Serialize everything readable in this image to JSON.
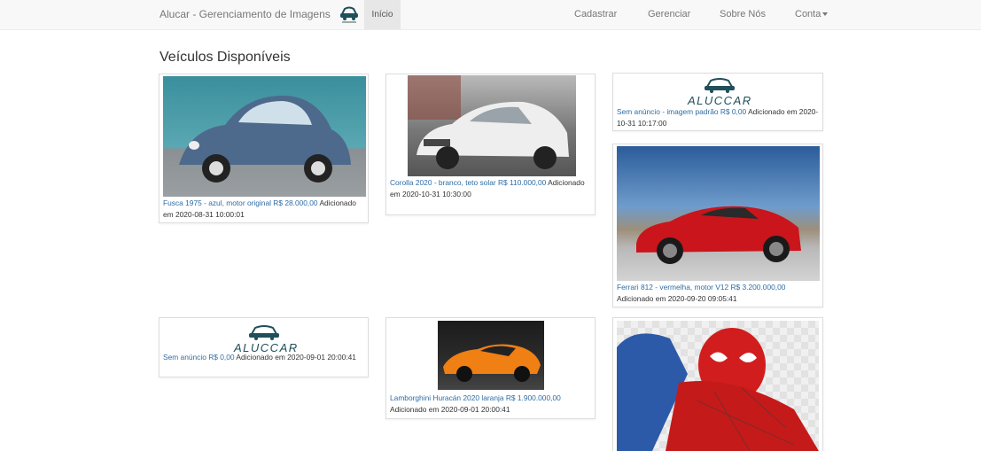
{
  "navbar": {
    "brand": "Alucar - Gerenciamento de Imagens",
    "home_label": "Início",
    "links": [
      "Cadastrar",
      "Gerenciar",
      "Sobre Nós"
    ],
    "account_label": "Conta"
  },
  "page": {
    "title": "Veículos Disponíveis"
  },
  "logo_text": "ALUCCAR",
  "cards": [
    {
      "price": "Fusca 1975 - azul, motor original R$ 28.000,00",
      "added": "Adicionado em 2020-08-31 10:00:01"
    },
    {
      "price": "Corolla 2020 - branco, teto solar R$ 110.000,00",
      "added": "Adicionado em 2020-10-31 10:30:00"
    },
    {
      "price": "Sem anúncio - imagem padrão R$ 0,00",
      "added": "Adicionado em 2020-10-31 10:17:00"
    },
    {
      "price": "Ferrari 812 - vermelha, motor V12 R$ 3.200.000,00",
      "added": "Adicionado em 2020-09-20 09:05:41"
    },
    {
      "price": "Sem anúncio R$ 0,00",
      "added": "Adicionado em 2020-09-01 20:00:41"
    },
    {
      "price": "Lamborghini Huracán 2020 laranja R$ 1.900.000,00",
      "added": "Adicionado em 2020-09-01 20:00:41"
    },
    {
      "price": "",
      "added": ""
    }
  ],
  "colors": {
    "navbar_bg": "#f8f8f8",
    "price_link": "#2e6da4",
    "logo_teal": "#1f4f5a"
  }
}
